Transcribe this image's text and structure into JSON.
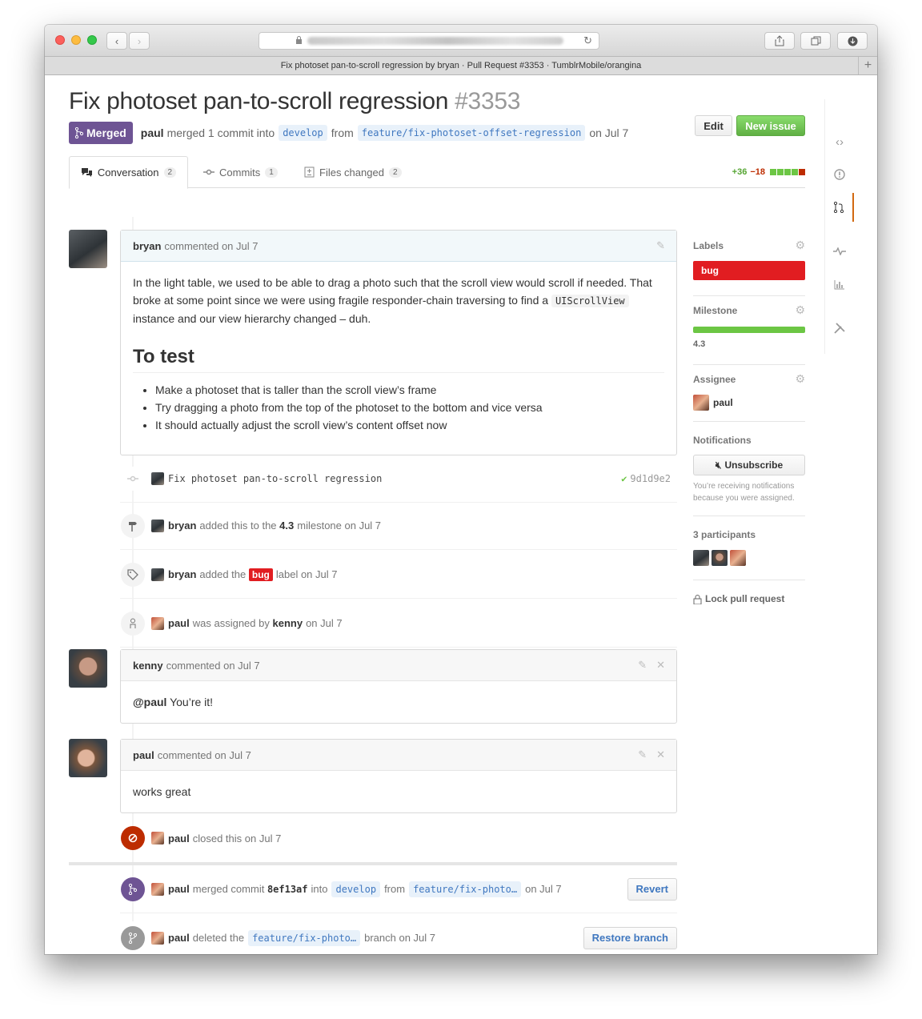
{
  "browser": {
    "tab_title": "Fix photoset pan-to-scroll regression by bryan · Pull Request #3353 · TumblrMobile/orangina",
    "new_tab_glyph": "+"
  },
  "pr": {
    "title": "Fix photoset pan-to-scroll regression",
    "number": "#3353",
    "edit_label": "Edit",
    "new_issue_label": "New issue",
    "state_label": "Merged",
    "meta_user": "paul",
    "meta_text1": "merged 1 commit into",
    "base_branch": "develop",
    "meta_from": "from",
    "head_branch": "feature/fix-photoset-offset-regression",
    "meta_date": "on Jul 7"
  },
  "tabs": [
    {
      "label": "Conversation",
      "count": "2",
      "icon": "comment-discussion-icon"
    },
    {
      "label": "Commits",
      "count": "1",
      "icon": "git-commit-icon"
    },
    {
      "label": "Files changed",
      "count": "2",
      "icon": "diff-icon"
    }
  ],
  "diffstat": {
    "additions": "+36",
    "deletions": "−18",
    "colors": [
      "#6cc644",
      "#6cc644",
      "#6cc644",
      "#6cc644",
      "#bd2c00"
    ]
  },
  "first_comment": {
    "author": "bryan",
    "meta": "commented on Jul 7",
    "p1a": "In the light table, we used to be able to drag a photo such that the scroll view would scroll if needed. That broke at some point since we were using fragile responder-chain traversing to find a",
    "p1code": "UIScrollView",
    "p1b": "instance and our view hierarchy changed – duh.",
    "heading": "To test",
    "items": [
      "Make a photoset that is taller than the scroll view’s frame",
      "Try dragging a photo from the top of the photoset to the bottom and vice versa",
      "It should actually adjust the scroll view’s content offset now"
    ]
  },
  "events": {
    "commit": {
      "message": "Fix photoset pan-to-scroll regression",
      "sha": "9d1d9e2"
    },
    "milestone": {
      "user": "bryan",
      "text1": "added this to the",
      "milestone": "4.3",
      "text2": "milestone on Jul 7"
    },
    "label": {
      "user": "bryan",
      "text1": "added the",
      "label": "bug",
      "text2": "label on Jul 7"
    },
    "assign": {
      "user": "paul",
      "text1": "was assigned by",
      "by": "kenny",
      "text2": "on Jul 7"
    },
    "closed": {
      "user": "paul",
      "text": "closed this on Jul 7"
    },
    "merged": {
      "user": "paul",
      "text1": "merged commit",
      "sha": "8ef13af",
      "text2": "into",
      "base": "develop",
      "text3": "from",
      "head": "feature/fix-photo…",
      "text4": "on Jul 7",
      "button": "Revert"
    },
    "deleted": {
      "user": "paul",
      "text1": "deleted the",
      "head": "feature/fix-photo…",
      "text2": "branch on Jul 7",
      "button": "Restore branch"
    }
  },
  "comment_kenny": {
    "author": "kenny",
    "meta": "commented on Jul 7",
    "mention": "@paul",
    "body": "You’re it!"
  },
  "comment_paul": {
    "author": "paul",
    "meta": "commented on Jul 7",
    "body": "works great"
  },
  "sidebar": {
    "labels_title": "Labels",
    "label": "bug",
    "label_color": "#e11d21",
    "milestone_title": "Milestone",
    "milestone_progress": 1.0,
    "milestone": "4.3",
    "assignee_title": "Assignee",
    "assignee": "paul",
    "notifications_title": "Notifications",
    "unsubscribe": "Unsubscribe",
    "reason": "You’re receiving notifications because you were assigned.",
    "participants": "3 participants",
    "lock": "Lock pull request"
  },
  "colors": {
    "merged": "#6e5494",
    "closed": "#bd2c00",
    "green": "#6cc644",
    "link": "#4078c0"
  }
}
